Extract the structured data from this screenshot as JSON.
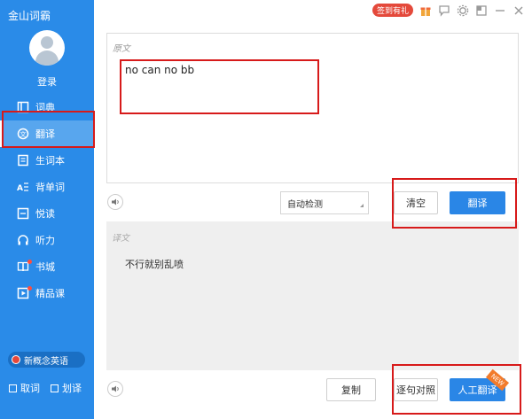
{
  "app": {
    "title": "金山词霸"
  },
  "user": {
    "login_label": "登录"
  },
  "sidebar": {
    "items": [
      {
        "label": "词典",
        "icon": "dictionary-icon",
        "active": false
      },
      {
        "label": "翻译",
        "icon": "translate-icon",
        "active": true
      },
      {
        "label": "生词本",
        "icon": "vocabulary-book-icon",
        "active": false
      },
      {
        "label": "背单词",
        "icon": "memorize-icon",
        "active": false
      },
      {
        "label": "悦读",
        "icon": "reading-icon",
        "active": false
      },
      {
        "label": "听力",
        "icon": "headphones-icon",
        "active": false
      },
      {
        "label": "书城",
        "icon": "bookstore-icon",
        "active": false
      },
      {
        "label": "精品课",
        "icon": "course-icon",
        "active": false
      }
    ],
    "promo": "新概念英语",
    "options": [
      {
        "label": "取词"
      },
      {
        "label": "划译"
      }
    ]
  },
  "topbar": {
    "badge": "签到有礼"
  },
  "translate": {
    "source_label": "原文",
    "source_text": "no can no bb",
    "lang_select": "自动检测",
    "clear_button": "清空",
    "translate_button": "翻译",
    "result_label": "译文",
    "result_text": "不行就别乱喷",
    "copy_button": "复制",
    "compare_button": "逐句对照",
    "human_button": "人工翻译",
    "new_tag": "NEW"
  },
  "colors": {
    "sidebar": "#2a8be8",
    "accent": "#2a86e6",
    "highlight_box": "#d71a1a"
  }
}
